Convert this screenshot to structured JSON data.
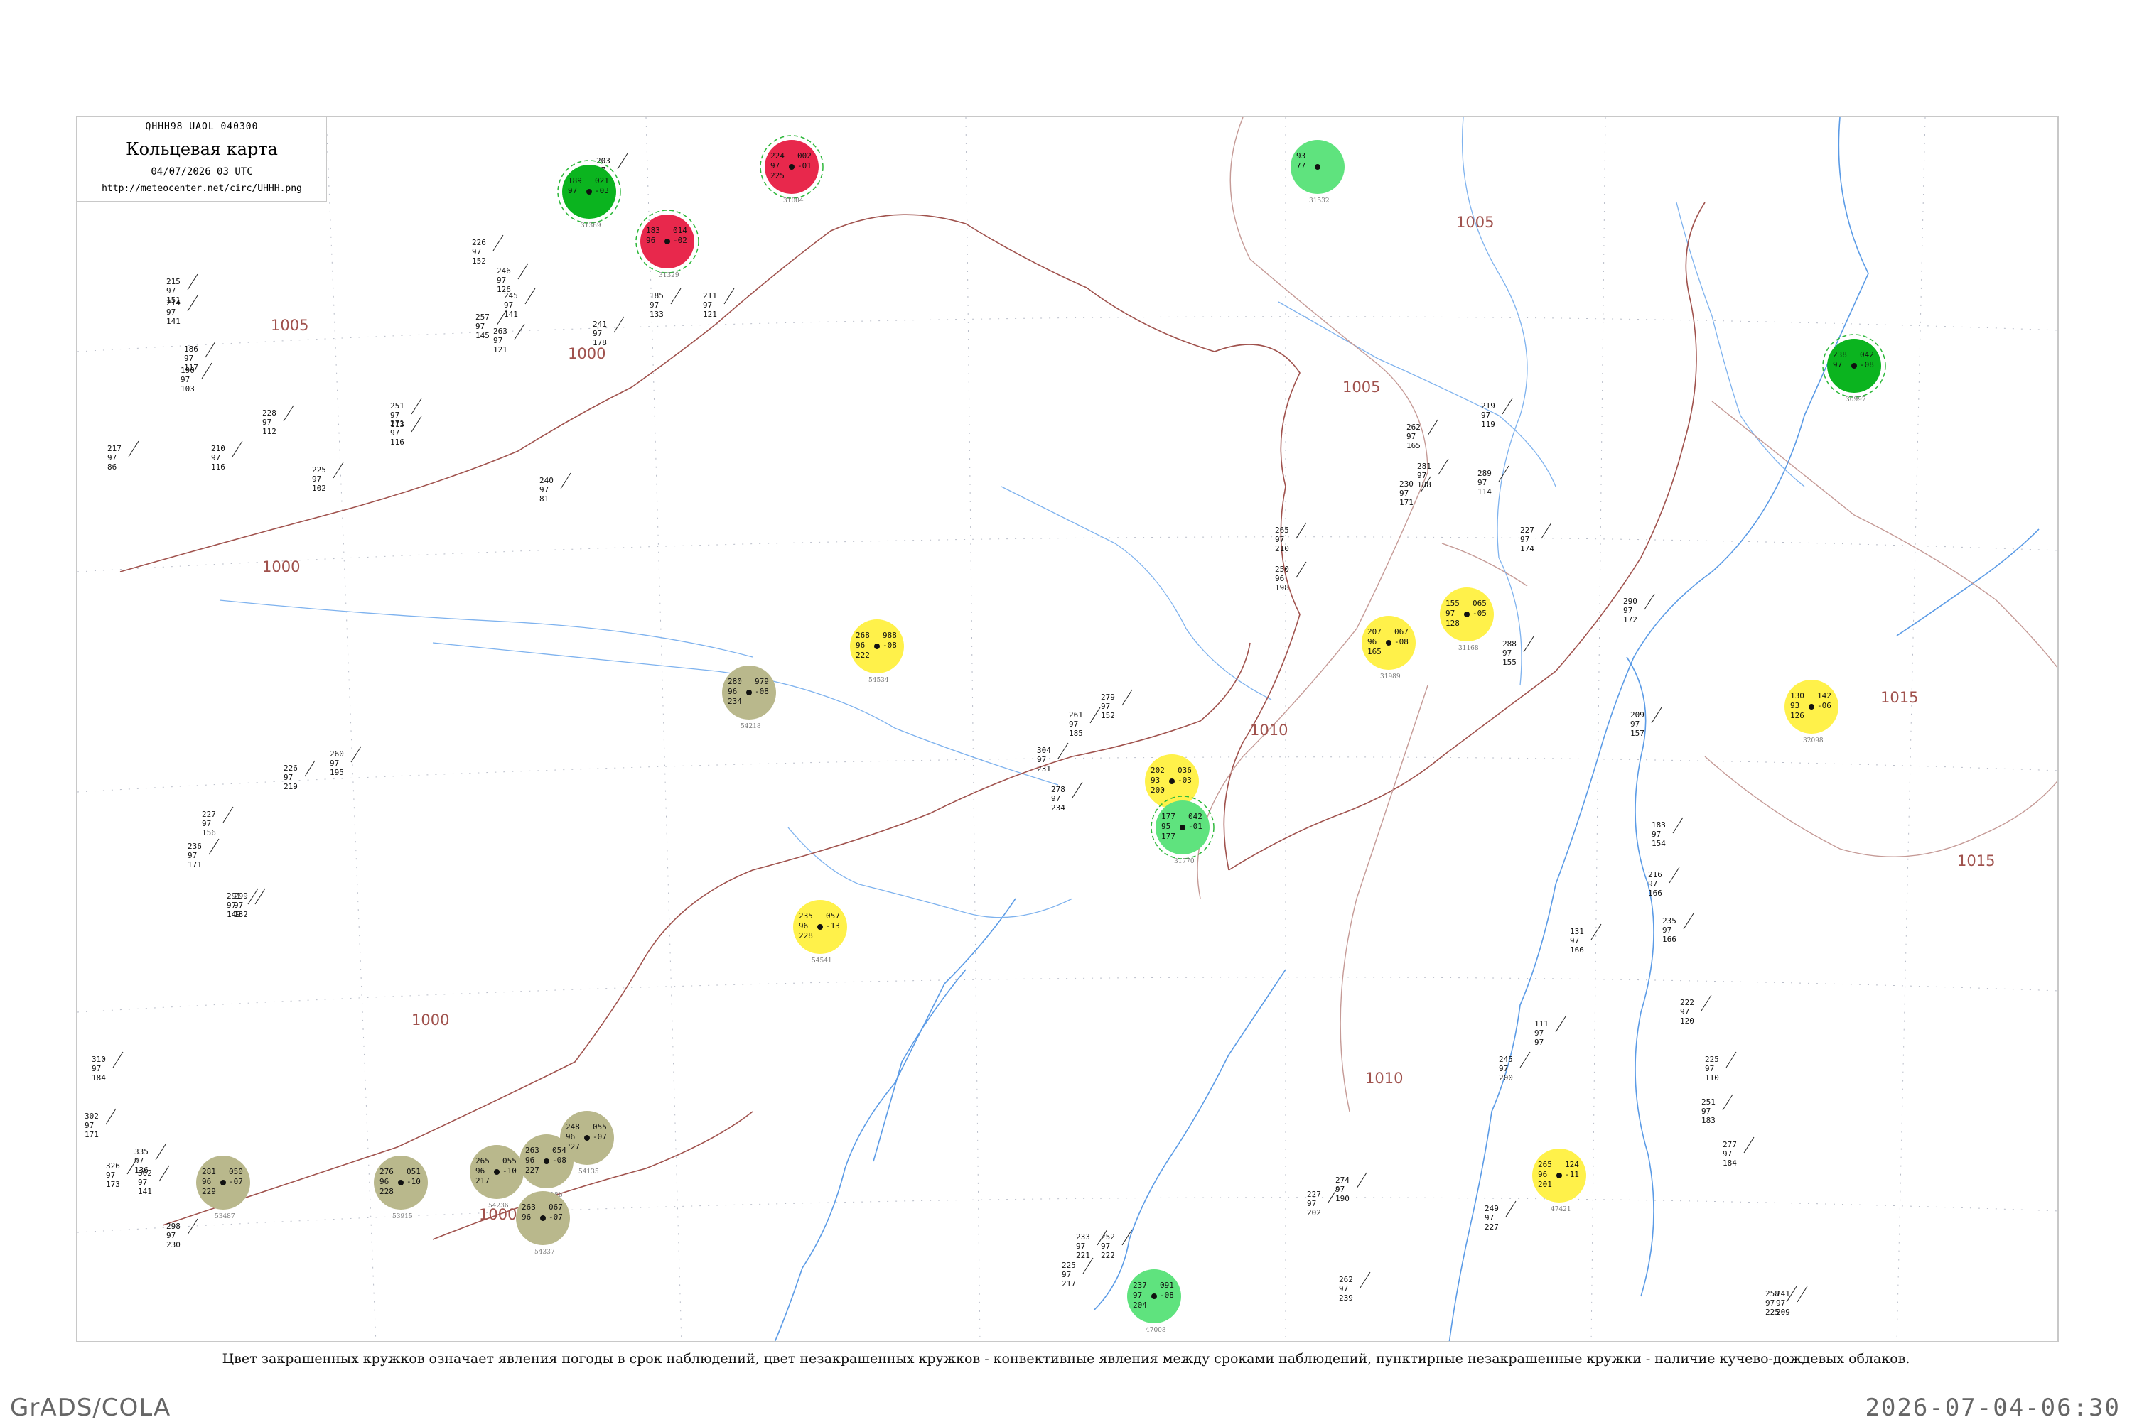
{
  "header": {
    "code": "QHHH98  UAOL  040300",
    "title": "Кольцевая карта",
    "datetime": "04/07/2026 03 UTC",
    "url": "http://meteocenter.net/circ/UHHH.png"
  },
  "caption": "Цвет закрашенных кружков означает явления погоды в срок наблюдений, цвет незакрашенных кружков - конвективные явления между сроками наблюдений, пунктирные незакрашенные кружки - наличие кучево-дождевых облаков.",
  "footer": {
    "left": "GrADS/COLA",
    "right": "2026-07-04-06:30"
  },
  "colors": {
    "rain": "#0bb41f",
    "haze": "#b9b88c",
    "fog_mist": "#fff14a",
    "thunder": "#e8284c",
    "showers": "#5fe37e",
    "cb_ring": "#2eb83b",
    "isobar": "#a0524d",
    "river": "#4a8fe0",
    "grid": "#9aa0b0"
  },
  "isobars": [
    "1005",
    "1000",
    "1000",
    "1000",
    "1000",
    "1005",
    "1005",
    "1010",
    "1010",
    "1015",
    "1015"
  ],
  "stations": [
    {
      "id": "31004",
      "row1": "224",
      "row1b": "002",
      "row2": "97",
      "row2b": "-01",
      "row3": "225",
      "wx": "thunder",
      "fill": true,
      "cb": true
    },
    {
      "id": "31329",
      "row1": "183",
      "row1b": "014",
      "row2": "96",
      "row2b": "-02",
      "row3": "",
      "wx": "thunder",
      "fill": true,
      "cb": true
    },
    {
      "id": "31168",
      "row1": "155",
      "row1b": "065",
      "row2": "97",
      "row2b": "-05",
      "row3": "128",
      "wx": "fog_mist",
      "fill": true,
      "cb": false
    },
    {
      "id": "31735",
      "row1": "202",
      "row1b": "036",
      "row2": "93",
      "row2b": "-03",
      "row3": "200",
      "wx": "fog_mist",
      "fill": true,
      "cb": false
    },
    {
      "id": "31989",
      "row1": "207",
      "row1b": "067",
      "row2": "96",
      "row2b": "-08",
      "row3": "165",
      "wx": "fog_mist",
      "fill": true,
      "cb": false
    },
    {
      "id": "32098",
      "row1": "130",
      "row1b": "142",
      "row2": "93",
      "row2b": "-06",
      "row3": "126",
      "wx": "fog_mist",
      "fill": true,
      "cb": false
    },
    {
      "id": "47421",
      "row1": "265",
      "row1b": "124",
      "row2": "96",
      "row2b": "-11",
      "row3": "201",
      "wx": "fog_mist",
      "fill": true,
      "cb": false
    },
    {
      "id": "54534",
      "row1": "268",
      "row1b": "988",
      "row2": "96",
      "row2b": "-08",
      "row3": "222",
      "wx": "fog_mist",
      "fill": true,
      "cb": false
    },
    {
      "id": "54541",
      "row1": "235",
      "row1b": "057",
      "row2": "96",
      "row2b": "-13",
      "row3": "228",
      "wx": "fog_mist",
      "fill": true,
      "cb": false
    },
    {
      "id": "54218",
      "row1": "280",
      "row1b": "979",
      "row2": "96",
      "row2b": "-08",
      "row3": "234",
      "wx": "haze",
      "fill": true,
      "cb": false
    },
    {
      "id": "53487",
      "row1": "281",
      "row1b": "050",
      "row2": "96",
      "row2b": "-07",
      "row3": "229",
      "wx": "haze",
      "fill": true,
      "cb": false
    },
    {
      "id": "54135",
      "row1": "248",
      "row1b": "055",
      "row2": "96",
      "row2b": "-07",
      "row3": "227",
      "wx": "haze",
      "fill": true,
      "cb": false
    },
    {
      "id": "54218b",
      "row1": "263",
      "row1b": "054",
      "row2": "96",
      "row2b": "-08",
      "row3": "227",
      "wx": "haze",
      "fill": true,
      "cb": false
    },
    {
      "id": "54236",
      "row1": "265",
      "row1b": "055",
      "row2": "96",
      "row2b": "-10",
      "row3": "217",
      "wx": "haze",
      "fill": true,
      "cb": false
    },
    {
      "id": "53915",
      "row1": "276",
      "row1b": "051",
      "row2": "96",
      "row2b": "-10",
      "row3": "228",
      "wx": "haze",
      "fill": true,
      "cb": false
    },
    {
      "id": "54337",
      "row1": "263",
      "row1b": "067",
      "row2": "96",
      "row2b": "-07",
      "row3": "",
      "wx": "haze",
      "fill": true,
      "cb": false
    },
    {
      "id": "47008",
      "row1": "237",
      "row1b": "091",
      "row2": "97",
      "row2b": "-08",
      "row3": "204",
      "wx": "showers",
      "fill": true,
      "cb": false
    },
    {
      "id": "31770",
      "row1": "177",
      "row1b": "042",
      "row2": "95",
      "row2b": "-01",
      "row3": "177",
      "wx": "showers",
      "fill": true,
      "cb": true
    },
    {
      "id": "31532",
      "row1": "93",
      "row1b": "",
      "row2": "77",
      "row2b": "",
      "row3": "",
      "wx": "showers",
      "fill": true,
      "cb": false
    },
    {
      "id": "31369",
      "row1": "189",
      "row1b": "021",
      "row2": "97",
      "row2b": "-03",
      "row3": "",
      "wx": "rain",
      "fill": true,
      "cb": true
    },
    {
      "id": "30997",
      "row1": "238",
      "row1b": "042",
      "row2": "97",
      "row2b": "-08",
      "row3": "",
      "wx": "rain",
      "fill": true,
      "cb": true
    }
  ],
  "plain_stations": [
    "226 97 152",
    "246 97 126",
    "245 97 141",
    "257 97 145",
    "263 97 121",
    "241 97 178",
    "203 97 153",
    "185 97 133",
    "211 97 121",
    "215 97 151",
    "214 97 141",
    "186 97 117",
    "190 97 103",
    "217 97 86",
    "210 97 116",
    "228 97 112",
    "251 97 113",
    "225 97 102",
    "271 97 116",
    "240 97 81",
    "279 97 152",
    "261 97 185",
    "260 97 195",
    "226 97 219",
    "227 97 156",
    "236 97 171",
    "291 97 149",
    "299 97 132",
    "310 97 184",
    "302 97 171",
    "326 97 173",
    "335 97 136",
    "302 97 141",
    "298 97 230",
    "304 97 231",
    "278 97 234",
    "250 96 198",
    "265 97 210",
    "230 97 171",
    "262 97 165",
    "281 97 188",
    "289 97 114",
    "219 97 119",
    "227 97 174",
    "288 97 155",
    "290 97 172",
    "209 97 157",
    "183 97 154",
    "216 97 166",
    "235 97 166",
    "222 97 120",
    "225 97 110",
    "251 97 183",
    "277 97 184",
    "274 97 190",
    "227 97 202",
    "241 97 209",
    "258 97 225",
    "252 97 222",
    "233 97 221",
    "225 97 217",
    "262 97 239",
    "249 97 227",
    "245 97 200",
    "111 97 97",
    "131 97 166"
  ]
}
